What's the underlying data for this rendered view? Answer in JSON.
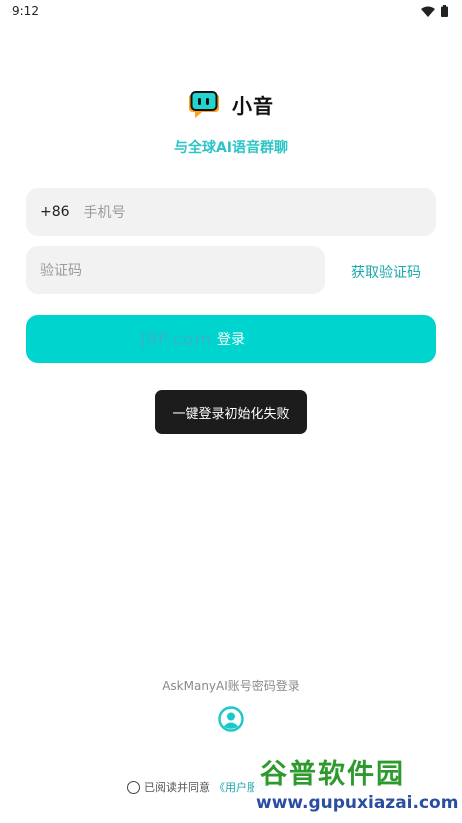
{
  "status_bar": {
    "time": "9:12"
  },
  "app": {
    "name": "小音",
    "slogan": "与全球AI语音群聊"
  },
  "login_form": {
    "country_code": "+86",
    "phone_placeholder": "手机号",
    "code_placeholder": "验证码",
    "get_code_label": "获取验证码",
    "login_label": "登录"
  },
  "toast": {
    "message": "一键登录初始化失败"
  },
  "alt_login": {
    "label": "AskManyAI账号密码登录"
  },
  "agreement": {
    "prefix": "已阅读并同意",
    "link": "《用户服务"
  },
  "watermarks": {
    "mid": "J9P.com",
    "brand_cn": "谷普软件园",
    "brand_url": "www.gupuxiazai.com"
  },
  "colors": {
    "accent": "#00d4ce",
    "accent_text": "#2cc4c6",
    "toast_bg": "#1c1c1c",
    "field_bg": "#f2f2f2"
  },
  "icons": {
    "wifi": "wifi-icon",
    "battery": "battery-icon",
    "logo": "chat-bubble-logo-icon",
    "user": "user-circle-icon"
  }
}
